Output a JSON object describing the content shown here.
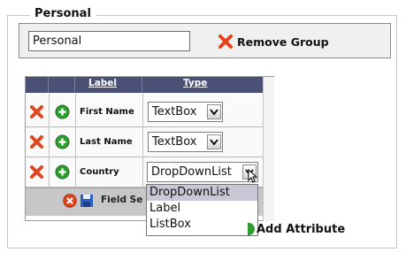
{
  "group": {
    "legend": "Personal",
    "name_value": "Personal",
    "remove_label": "Remove Group"
  },
  "grid": {
    "columns": [
      "Label",
      "Type"
    ],
    "rows": [
      {
        "label": "First Name",
        "type": "TextBox"
      },
      {
        "label": "Last Name",
        "type": "TextBox"
      },
      {
        "label": "Country",
        "type": "DropDownList"
      }
    ],
    "footer_text": "Field Se"
  },
  "dropdown": {
    "options": [
      "DropDownList",
      "Label",
      "ListBox"
    ],
    "selected": "DropDownList"
  },
  "add_attribute_label": "Add Attribute",
  "icons": {
    "delete": "x-icon",
    "add": "plus-circle-icon",
    "cancel": "cancel-icon",
    "save": "save-icon",
    "dropdown": "chevron-down-icon"
  },
  "colors": {
    "header": "#4b5076",
    "delete": "#e2451c",
    "add": "#2e9c2e",
    "save": "#2b5fc2",
    "dropdown_highlight": "#c7c7d6"
  }
}
